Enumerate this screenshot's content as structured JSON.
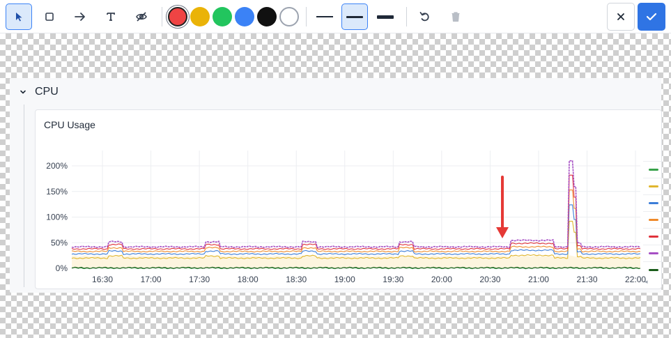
{
  "toolbar": {
    "tools": [
      {
        "name": "select-tool",
        "icon": "cursor-icon",
        "active": true
      },
      {
        "name": "rectangle-tool",
        "icon": "square-icon",
        "active": false
      },
      {
        "name": "arrow-tool",
        "icon": "arrow-right-icon",
        "active": false
      },
      {
        "name": "text-tool",
        "icon": "text-icon",
        "active": false
      },
      {
        "name": "hide-tool",
        "icon": "eye-off-icon",
        "active": false
      }
    ],
    "colors": [
      "#ef4444",
      "#eab308",
      "#22c55e",
      "#3b82f6",
      "#111111",
      "#ffffff"
    ],
    "selected_color": "#ef4444",
    "stroke_widths": [
      "thin",
      "medium",
      "thick"
    ],
    "selected_stroke": "medium",
    "cancel_icon": "close-icon",
    "confirm_icon": "check-icon"
  },
  "dashboard": {
    "row_title": "CPU",
    "panel_title": "CPU Usage"
  },
  "chart_data": {
    "type": "line",
    "title": "CPU Usage",
    "x_ticks": [
      "16:30",
      "17:00",
      "17:30",
      "18:00",
      "18:30",
      "19:00",
      "19:30",
      "20:00",
      "20:30",
      "21:00",
      "21:30",
      "22:00"
    ],
    "y_ticks": [
      "0%",
      "50%",
      "100%",
      "150%",
      "200%"
    ],
    "ylim": [
      0,
      230
    ],
    "xlim": [
      "16:11",
      "22:03"
    ],
    "grid": true,
    "legend_position": "right",
    "series": [
      {
        "color": "#37a24a",
        "level": 0.5,
        "bump": 0
      },
      {
        "color": "#e0b62e",
        "level": 20,
        "bump": 6
      },
      {
        "color": "#3b7dd8",
        "level": 28,
        "bump": 8
      },
      {
        "color": "#ef8a2b",
        "level": 33,
        "bump": 10
      },
      {
        "color": "#e0323c",
        "level": 38,
        "bump": 12
      },
      {
        "color": "#a64fc4",
        "level": 42,
        "bump": 14
      },
      {
        "color": "#1a5c1a",
        "level": 1,
        "bump": 0
      }
    ],
    "events": [
      {
        "time": "16:34",
        "peak": 52
      },
      {
        "time": "17:34",
        "peak": 52
      },
      {
        "time": "18:34",
        "peak": 52
      },
      {
        "time": "19:34",
        "peak": 52
      },
      {
        "time": "20:43",
        "peak": 55
      },
      {
        "time": "21:20",
        "peak": 210
      }
    ]
  },
  "annotation": {
    "type": "arrow",
    "color": "#e53935",
    "points_to_time": "20:43",
    "points_to_value": 55
  }
}
